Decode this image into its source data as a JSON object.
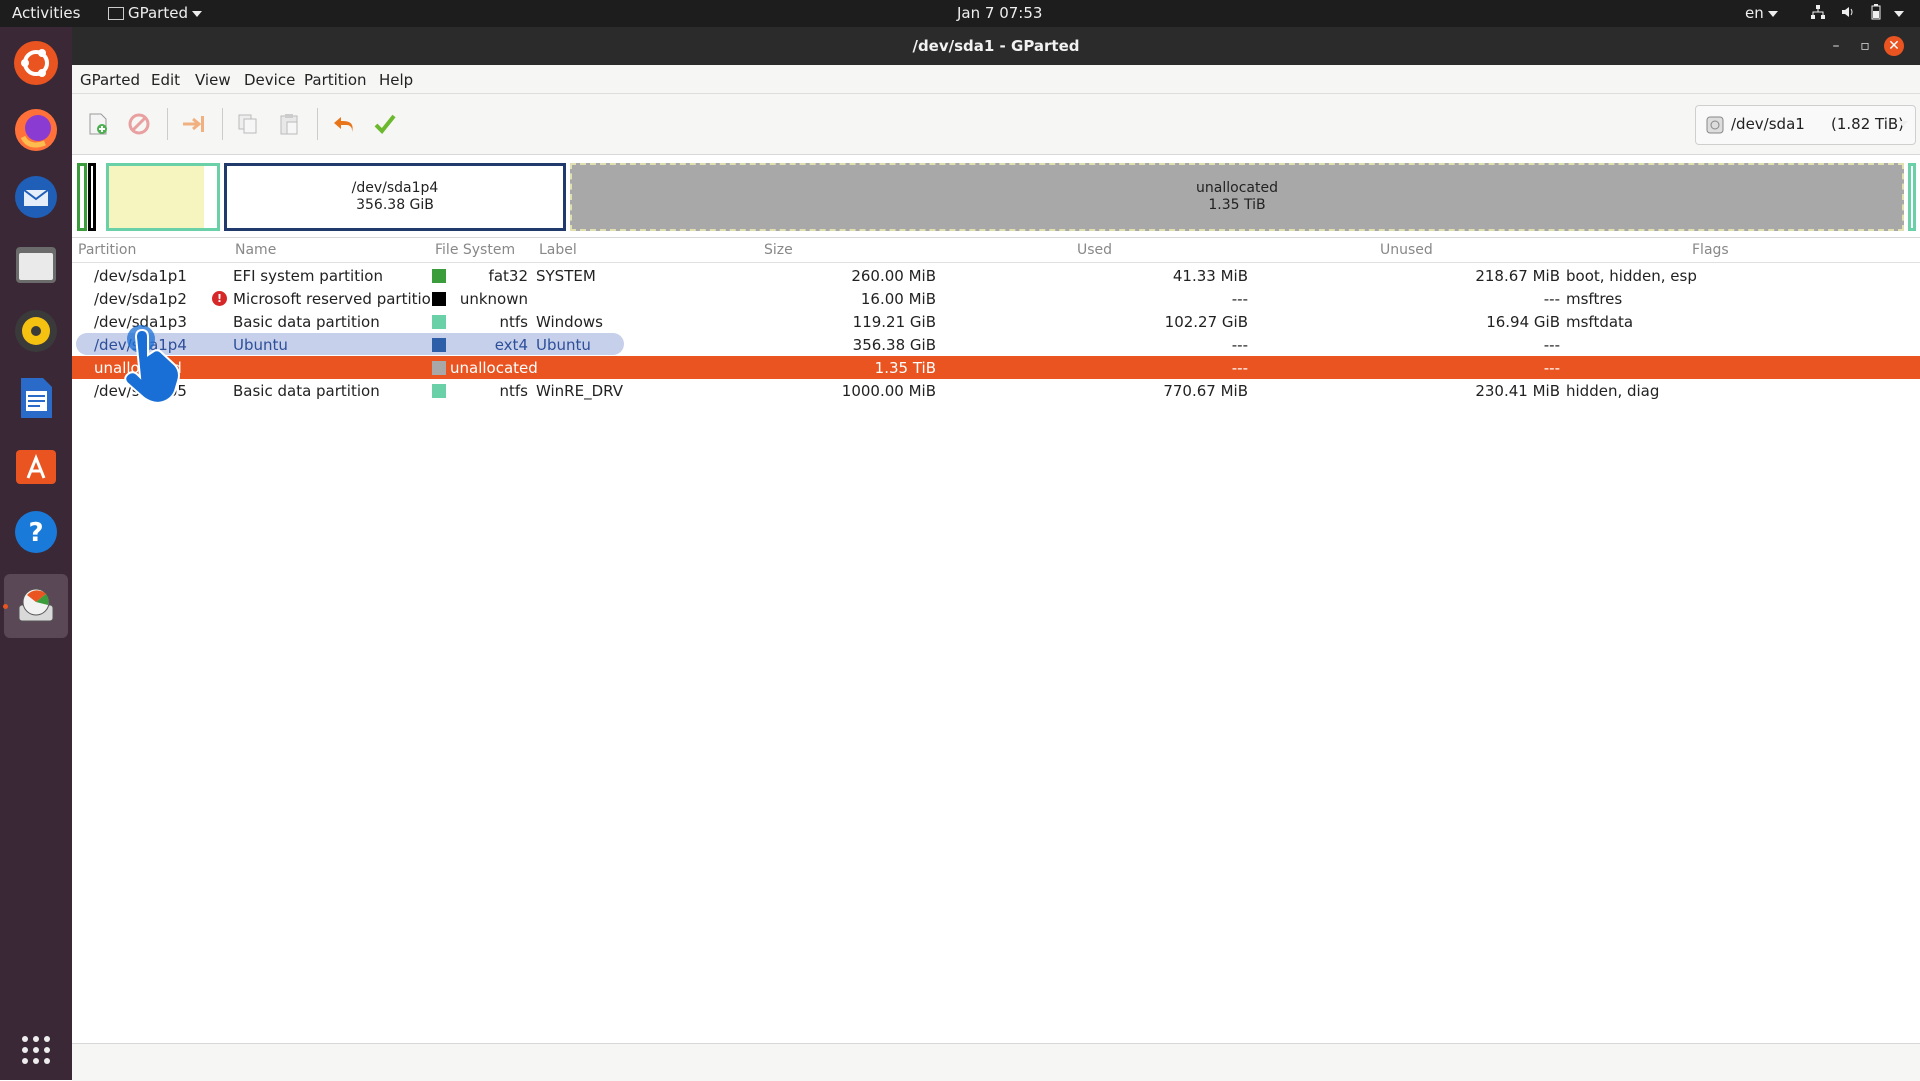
{
  "topbar": {
    "activities": "Activities",
    "app_name": "GParted",
    "clock": "Jan 7  07:53",
    "lang": "en"
  },
  "window": {
    "title": "/dev/sda1 - GParted"
  },
  "menu": [
    "GParted",
    "Edit",
    "View",
    "Device",
    "Partition",
    "Help"
  ],
  "device": {
    "name": "/dev/sda1",
    "size": "(1.82 TiB)"
  },
  "graph": {
    "p4_name": "/dev/sda1p4",
    "p4_size": "356.38 GiB",
    "unalloc_name": "unallocated",
    "unalloc_size": "1.35 TiB"
  },
  "columns": [
    "Partition",
    "Name",
    "File System",
    "Label",
    "Size",
    "Used",
    "Unused",
    "Flags"
  ],
  "rows": [
    {
      "partition": "/dev/sda1p1",
      "name": "EFI system partition",
      "fs": "fat32",
      "label": "SYSTEM",
      "size": "260.00 MiB",
      "used": "41.33 MiB",
      "unused": "218.67 MiB",
      "flags": "boot, hidden, esp",
      "color": "#3a9c3a"
    },
    {
      "partition": "/dev/sda1p2",
      "name": "Microsoft reserved partition",
      "fs": "unknown",
      "label": "",
      "size": "16.00 MiB",
      "used": "---",
      "unused": "---",
      "flags": "msftres",
      "color": "#000000"
    },
    {
      "partition": "/dev/sda1p3",
      "name": "Basic data partition",
      "fs": "ntfs",
      "label": "Windows",
      "size": "119.21 GiB",
      "used": "102.27 GiB",
      "unused": "16.94 GiB",
      "flags": "msftdata",
      "color": "#6ad0a8"
    },
    {
      "partition": "/dev/sda1p4",
      "name": "Ubuntu",
      "fs": "ext4",
      "label": "Ubuntu",
      "size": "356.38 GiB",
      "used": "---",
      "unused": "---",
      "flags": "",
      "color": "#2d5fa8"
    },
    {
      "partition": "unallocated",
      "name": "",
      "fs": "unallocated",
      "label": "",
      "size": "1.35 TiB",
      "used": "---",
      "unused": "---",
      "flags": "",
      "color": "#a8a8a8"
    },
    {
      "partition": "/dev/sda1p5",
      "name": "Basic data partition",
      "fs": "ntfs",
      "label": "WinRE_DRV",
      "size": "1000.00 MiB",
      "used": "770.67 MiB",
      "unused": "230.41 MiB",
      "flags": "hidden, diag",
      "color": "#6ad0a8"
    }
  ],
  "colors": {
    "selected_row": "#c6d0ea",
    "unallocated_row": "#e95420",
    "accent": "#e95420"
  }
}
